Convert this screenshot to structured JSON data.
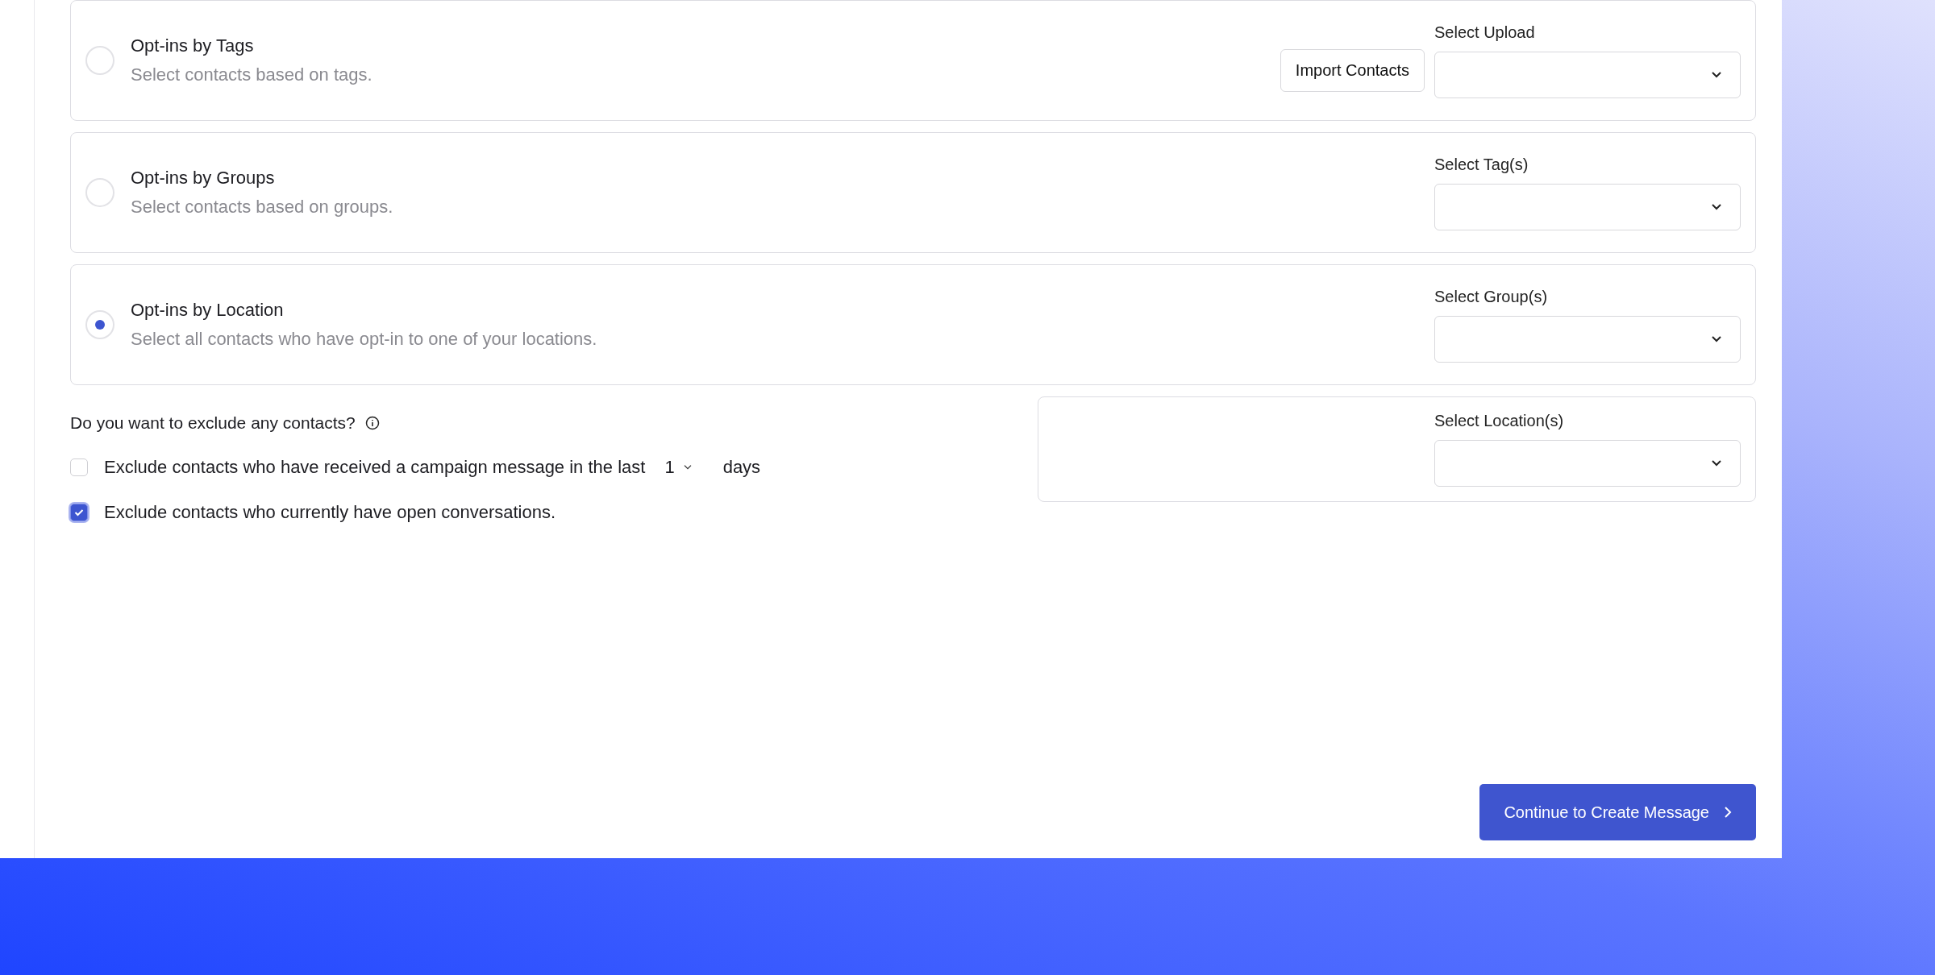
{
  "options": [
    {
      "title": "Opt-ins by Tags",
      "description": "Select contacts based on tags.",
      "selected": false,
      "button": "Import Contacts",
      "select_label": "Select Upload"
    },
    {
      "title": "Opt-ins by Groups",
      "description": "Select contacts based on groups.",
      "selected": false,
      "select_label": "Select Tag(s)"
    },
    {
      "title": "Opt-ins by Location",
      "description": "Select all contacts who have opt-in to one of your locations.",
      "selected": true,
      "select_label": "Select Group(s)"
    }
  ],
  "extra_select": {
    "label": "Select Location(s)"
  },
  "exclude": {
    "question": "Do you want to exclude any contacts?",
    "options": [
      {
        "kind": "days",
        "label": "Exclude contacts who have received a campaign message in the last",
        "value": "1",
        "suffix": "days",
        "checked": false
      },
      {
        "kind": "plain",
        "label": "Exclude contacts who currently have open conversations.",
        "checked": true
      }
    ]
  },
  "continue_button": "Continue to Create Message"
}
